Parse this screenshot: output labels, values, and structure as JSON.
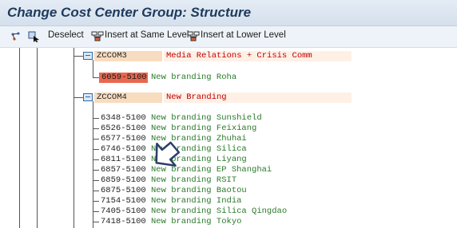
{
  "window": {
    "title": "Change Cost Center Group: Structure"
  },
  "toolbar": {
    "deselect_label": "Deselect",
    "insert_same_label": "Insert at Same Level",
    "insert_lower_label": "Insert at Lower Level"
  },
  "tree": {
    "group1": {
      "code": "ZCCOM3",
      "description": "Media Relations + Crisis Comm"
    },
    "group1_child": {
      "code": "6059-5100",
      "description": "New branding Roha"
    },
    "group2": {
      "code": "ZCCOM4",
      "description": "New Branding"
    },
    "group2_children": [
      {
        "code": "6348-5100",
        "description": "New branding Sunshield"
      },
      {
        "code": "6526-5100",
        "description": "New branding Feixiang"
      },
      {
        "code": "6577-5100",
        "description": "New branding Zhuhai"
      },
      {
        "code": "6746-5100",
        "description": "New branding Silica"
      },
      {
        "code": "6811-5100",
        "description": "New branding Liyang"
      },
      {
        "code": "6857-5100",
        "description": "New branding EP Shanghai"
      },
      {
        "code": "6859-5100",
        "description": "New branding RSIT"
      },
      {
        "code": "6875-5100",
        "description": "New branding Baotou"
      },
      {
        "code": "7154-5100",
        "description": "New branding India"
      },
      {
        "code": "7405-5100",
        "description": "New branding Silica Qingdao"
      },
      {
        "code": "7418-5100",
        "description": "New branding Tokyo"
      }
    ]
  },
  "colors": {
    "group_highlight": "#f8dcc0",
    "selected_node": "#e8684f",
    "description_red": "#c00000",
    "leaf_text_green": "#2a7a2a",
    "toolbar_group_border": "#2b3f6a"
  }
}
